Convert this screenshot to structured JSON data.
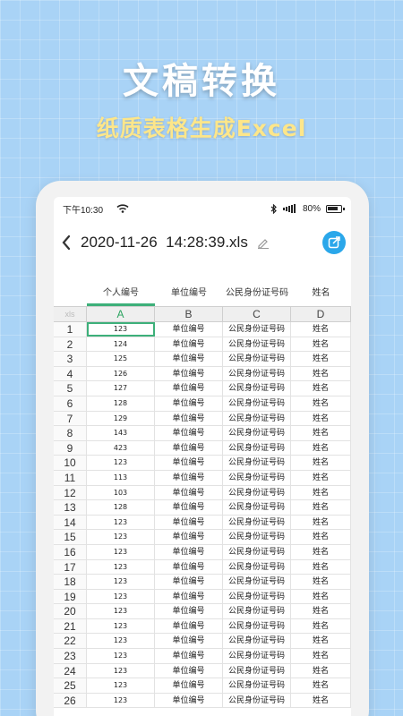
{
  "promo": {
    "title": "文稿转换",
    "subtitle": "纸质表格生成Excel"
  },
  "status_bar": {
    "time": "下午10:30",
    "battery": "80%",
    "icons": [
      "wifi-icon",
      "bluetooth-icon",
      "signal-icon",
      "battery-icon"
    ]
  },
  "toolbar": {
    "file_name": "2020-11-26  14:28:39.xls",
    "icons": [
      "back-arrow-icon",
      "pencil-edit-icon",
      "share-square-icon"
    ],
    "accent_color": "#2aa7ea"
  },
  "sheet": {
    "header_labels": [
      "个人编号",
      "单位编号",
      "公民身份证号码",
      "姓名"
    ],
    "corner_label": "xls",
    "column_letters": [
      "A",
      "B",
      "C",
      "D"
    ],
    "selected_cell": "A1",
    "rows": [
      {
        "n": "1",
        "a": "123",
        "b": "单位编号",
        "c": "公民身份证号码",
        "d": "姓名"
      },
      {
        "n": "2",
        "a": "124",
        "b": "单位编号",
        "c": "公民身份证号码",
        "d": "姓名"
      },
      {
        "n": "3",
        "a": "125",
        "b": "单位编号",
        "c": "公民身份证号码",
        "d": "姓名"
      },
      {
        "n": "4",
        "a": "126",
        "b": "单位编号",
        "c": "公民身份证号码",
        "d": "姓名"
      },
      {
        "n": "5",
        "a": "127",
        "b": "单位编号",
        "c": "公民身份证号码",
        "d": "姓名"
      },
      {
        "n": "6",
        "a": "128",
        "b": "单位编号",
        "c": "公民身份证号码",
        "d": "姓名"
      },
      {
        "n": "7",
        "a": "129",
        "b": "单位编号",
        "c": "公民身份证号码",
        "d": "姓名"
      },
      {
        "n": "8",
        "a": "143",
        "b": "单位编号",
        "c": "公民身份证号码",
        "d": "姓名"
      },
      {
        "n": "9",
        "a": "423",
        "b": "单位编号",
        "c": "公民身份证号码",
        "d": "姓名"
      },
      {
        "n": "10",
        "a": "123",
        "b": "单位编号",
        "c": "公民身份证号码",
        "d": "姓名"
      },
      {
        "n": "11",
        "a": "113",
        "b": "单位编号",
        "c": "公民身份证号码",
        "d": "姓名"
      },
      {
        "n": "12",
        "a": "103",
        "b": "单位编号",
        "c": "公民身份证号码",
        "d": "姓名"
      },
      {
        "n": "13",
        "a": "128",
        "b": "单位编号",
        "c": "公民身份证号码",
        "d": "姓名"
      },
      {
        "n": "14",
        "a": "123",
        "b": "单位编号",
        "c": "公民身份证号码",
        "d": "姓名"
      },
      {
        "n": "15",
        "a": "123",
        "b": "单位编号",
        "c": "公民身份证号码",
        "d": "姓名"
      },
      {
        "n": "16",
        "a": "123",
        "b": "单位编号",
        "c": "公民身份证号码",
        "d": "姓名"
      },
      {
        "n": "17",
        "a": "123",
        "b": "单位编号",
        "c": "公民身份证号码",
        "d": "姓名"
      },
      {
        "n": "18",
        "a": "123",
        "b": "单位编号",
        "c": "公民身份证号码",
        "d": "姓名"
      },
      {
        "n": "19",
        "a": "123",
        "b": "单位编号",
        "c": "公民身份证号码",
        "d": "姓名"
      },
      {
        "n": "20",
        "a": "123",
        "b": "单位编号",
        "c": "公民身份证号码",
        "d": "姓名"
      },
      {
        "n": "21",
        "a": "123",
        "b": "单位编号",
        "c": "公民身份证号码",
        "d": "姓名"
      },
      {
        "n": "22",
        "a": "123",
        "b": "单位编号",
        "c": "公民身份证号码",
        "d": "姓名"
      },
      {
        "n": "23",
        "a": "123",
        "b": "单位编号",
        "c": "公民身份证号码",
        "d": "姓名"
      },
      {
        "n": "24",
        "a": "123",
        "b": "单位编号",
        "c": "公民身份证号码",
        "d": "姓名"
      },
      {
        "n": "25",
        "a": "123",
        "b": "单位编号",
        "c": "公民身份证号码",
        "d": "姓名"
      },
      {
        "n": "26",
        "a": "123",
        "b": "单位编号",
        "c": "公民身份证号码",
        "d": "姓名"
      }
    ]
  }
}
